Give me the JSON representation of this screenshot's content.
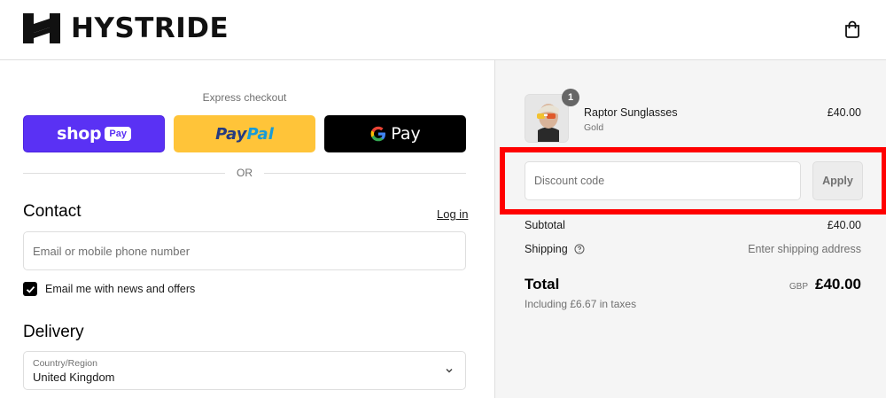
{
  "header": {
    "brand": "HYSTRIDE",
    "cart_icon": "shopping-bag-icon"
  },
  "express": {
    "label": "Express checkout",
    "shop_label": "shop",
    "shop_badge": "Pay",
    "paypal_part1": "Pay",
    "paypal_part2": "Pal",
    "gpay_label": "Pay",
    "or_label": "OR"
  },
  "contact": {
    "title": "Contact",
    "login_label": "Log in",
    "email_placeholder": "Email or mobile phone number",
    "newsletter_label": "Email me with news and offers",
    "newsletter_checked": true
  },
  "delivery": {
    "title": "Delivery",
    "country_label": "Country/Region",
    "country_value": "United Kingdom"
  },
  "summary": {
    "product": {
      "name": "Raptor Sunglasses",
      "variant": "Gold",
      "price": "£40.00",
      "quantity": "1"
    },
    "discount_placeholder": "Discount code",
    "apply_label": "Apply",
    "subtotal_label": "Subtotal",
    "subtotal_value": "£40.00",
    "shipping_label": "Shipping",
    "shipping_value": "Enter shipping address",
    "total_label": "Total",
    "currency": "GBP",
    "total_value": "£40.00",
    "taxes_note": "Including £6.67 in taxes"
  },
  "colors": {
    "shop_pay": "#5a31f4",
    "paypal": "#ffc439",
    "gpay": "#000000",
    "highlight": "#ff0000",
    "summary_bg": "#f5f5f5"
  }
}
